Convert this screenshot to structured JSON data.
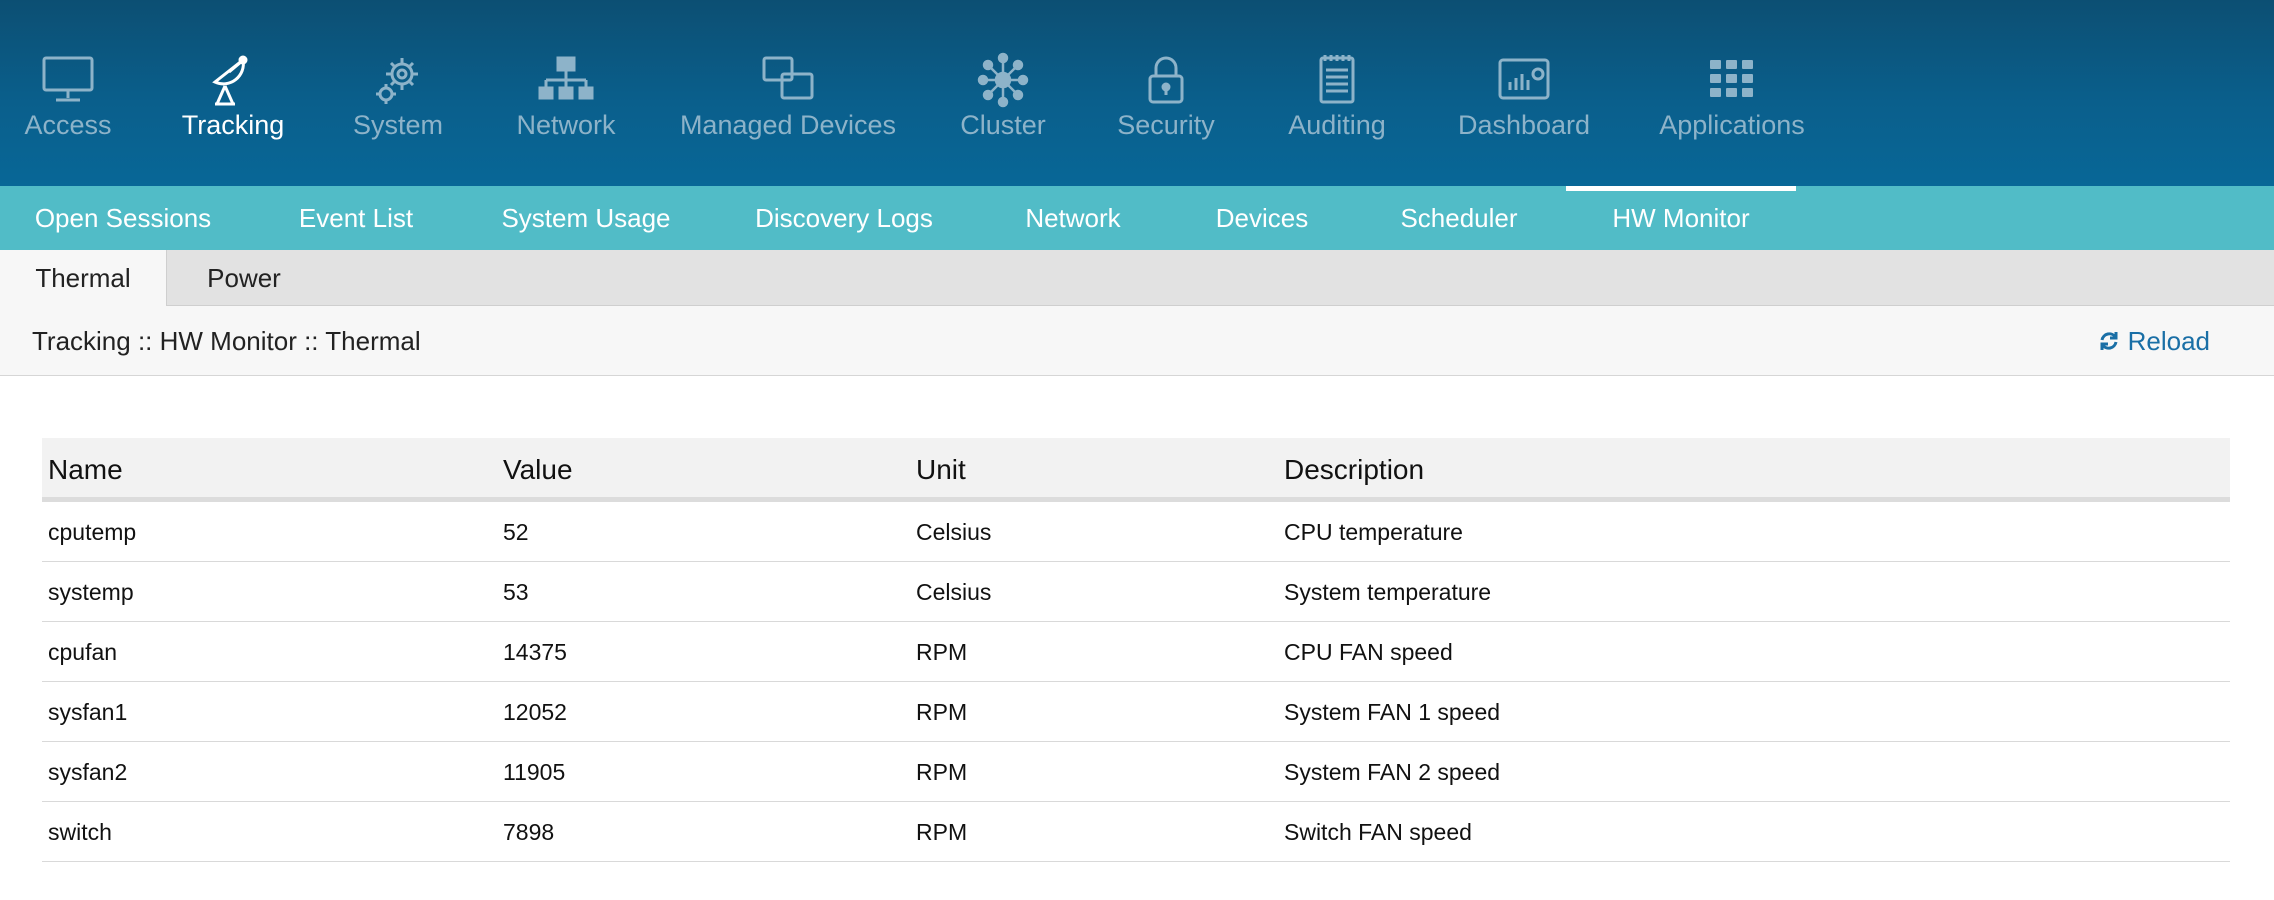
{
  "topnav": {
    "items": [
      {
        "label": "Access",
        "icon": "monitor-icon",
        "active": false
      },
      {
        "label": "Tracking",
        "icon": "satellite-dish-icon",
        "active": true
      },
      {
        "label": "System",
        "icon": "gears-icon",
        "active": false
      },
      {
        "label": "Network",
        "icon": "network-tree-icon",
        "active": false
      },
      {
        "label": "Managed Devices",
        "icon": "managed-devices-icon",
        "active": false
      },
      {
        "label": "Cluster",
        "icon": "cluster-icon",
        "active": false
      },
      {
        "label": "Security",
        "icon": "lock-icon",
        "active": false
      },
      {
        "label": "Auditing",
        "icon": "notepad-icon",
        "active": false
      },
      {
        "label": "Dashboard",
        "icon": "dashboard-icon",
        "active": false
      },
      {
        "label": "Applications",
        "icon": "grid-icon",
        "active": false
      }
    ]
  },
  "subnav": {
    "items": [
      {
        "label": "Open Sessions",
        "active": false
      },
      {
        "label": "Event List",
        "active": false
      },
      {
        "label": "System Usage",
        "active": false
      },
      {
        "label": "Discovery Logs",
        "active": false
      },
      {
        "label": "Network",
        "active": false
      },
      {
        "label": "Devices",
        "active": false
      },
      {
        "label": "Scheduler",
        "active": false
      },
      {
        "label": "HW Monitor",
        "active": true
      }
    ]
  },
  "tabs": {
    "items": [
      {
        "label": "Thermal",
        "active": true
      },
      {
        "label": "Power",
        "active": false
      }
    ]
  },
  "breadcrumb": {
    "text": "Tracking :: HW Monitor :: Thermal"
  },
  "reload": {
    "label": "Reload",
    "icon": "refresh-icon"
  },
  "table": {
    "columns": [
      "Name",
      "Value",
      "Unit",
      "Description"
    ],
    "rows": [
      [
        "cputemp",
        "52",
        "Celsius",
        "CPU temperature"
      ],
      [
        "systemp",
        "53",
        "Celsius",
        "System temperature"
      ],
      [
        "cpufan",
        "14375",
        "RPM",
        "CPU FAN speed"
      ],
      [
        "sysfan1",
        "12052",
        "RPM",
        "System FAN 1 speed"
      ],
      [
        "sysfan2",
        "11905",
        "RPM",
        "System FAN 2 speed"
      ],
      [
        "switch",
        "7898",
        "RPM",
        "Switch FAN speed"
      ]
    ]
  },
  "colors": {
    "topnav_bg": "#0a5f8c",
    "subnav_bg": "#51bcc7",
    "inactive_nav_text": "#8db3c9",
    "active_nav_text": "#ffffff",
    "link": "#1a6fa6"
  }
}
